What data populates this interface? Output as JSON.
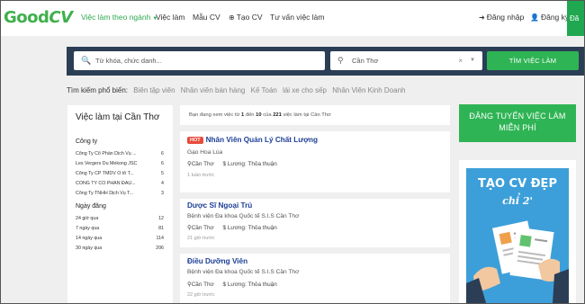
{
  "brand": {
    "logo_g": "Good",
    "logo_cv": "CV"
  },
  "nav": {
    "jobs_by_industry": "Việc làm theo ngành",
    "jobs": "Việc làm",
    "cv_templates": "Mẫu CV",
    "create_cv": "Tạo CV",
    "career_advice": "Tư vấn việc làm",
    "login": "Đăng nhập",
    "register": "Đăng ký",
    "corner": "Đă"
  },
  "search": {
    "keyword_placeholder": "Từ khóa, chức danh...",
    "location_value": "Cần Thơ",
    "button_label": "TÌM VIỆC LÀM"
  },
  "popular": {
    "label": "Tìm kiếm phổ biến:",
    "terms": [
      "Biên tập viên",
      "Nhân viên bán hàng",
      "Kế Toán",
      "lái xe cho sếp",
      "Nhân Viên Kinh Doanh"
    ]
  },
  "sidebar": {
    "title": "Việc làm tại Cần Thơ",
    "company_heading": "Công ty",
    "companies": [
      {
        "name": "Công Ty Cổ Phần Dịch Vụ ...",
        "count": "6"
      },
      {
        "name": "Les Vergers Du Mekong JSC",
        "count": "6"
      },
      {
        "name": "Công Ty CP TMDV Ô tô T...",
        "count": "5"
      },
      {
        "name": "CÔNG TY CỔ PHẦN ĐẦU...",
        "count": "4"
      },
      {
        "name": "Công Ty TNHH Dịch Vụ T...",
        "count": "3"
      }
    ],
    "date_heading": "Ngày đăng",
    "dates": [
      {
        "label": "24 giờ qua",
        "count": "12"
      },
      {
        "label": "7 ngày qua",
        "count": "81"
      },
      {
        "label": "14 ngày qua",
        "count": "114"
      },
      {
        "label": "30 ngày qua",
        "count": "206"
      }
    ]
  },
  "listing": {
    "info_prefix": "Bạn đang xem việc từ ",
    "from": "1",
    "info_mid1": " đến ",
    "to": "10",
    "info_mid2": " của ",
    "total": "221",
    "info_suffix": " việc làm tại Cần Thơ",
    "hot_label": "HOT",
    "salary_prefix": "Lương: ",
    "jobs": [
      {
        "title": "Nhân Viên Quản Lý Chất Lượng",
        "company": "Gạo Hoa Lúa",
        "location": "Cần Thơ",
        "salary": "Thỏa thuận",
        "posted": "1 tuần trước",
        "hot": true
      },
      {
        "title": "Dược Sĩ Ngoại Trú",
        "company": "Bệnh viện Đa khoa Quốc tế S.I.S Cần Thơ",
        "location": "Cần Thơ",
        "salary": "Thỏa thuận",
        "posted": "21 giờ trước",
        "hot": false
      },
      {
        "title": "Điều Dưỡng Viên",
        "company": "Bệnh viện Đa khoa Quốc tế S.I.S Cần Thơ",
        "location": "Cần Thơ",
        "salary": "Thỏa thuận",
        "posted": "22 giờ trước",
        "hot": false
      }
    ]
  },
  "ads": {
    "post_job_line1": "ĐĂNG TUYỂN VIỆC LÀM",
    "post_job_line2": "MIỄN PHÍ",
    "cv_title": "TẠO CV ĐẸP",
    "cv_sub": "chỉ 2'"
  },
  "colors": {
    "brand_green": "#2fb455",
    "navy": "#2b3e55",
    "link_blue": "#1d3f96",
    "hot_red": "#e74c3c"
  }
}
